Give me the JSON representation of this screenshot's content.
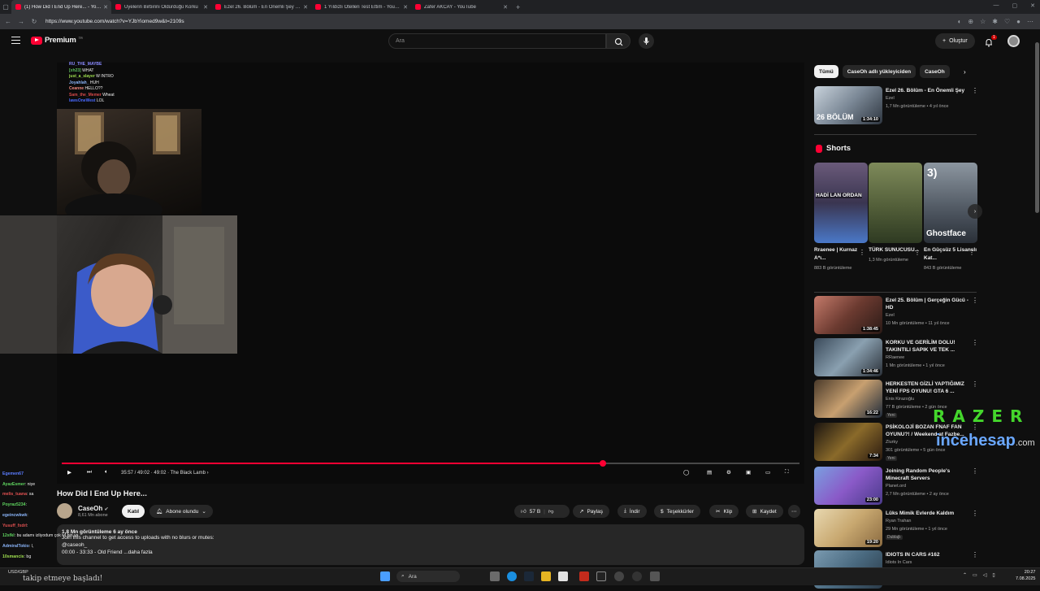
{
  "browser": {
    "tabs": [
      {
        "title": "(1) How Did I End Up Here... - YouTube",
        "active": true
      },
      {
        "title": "Üyelerin Birbirini Öldürdüğü Korku",
        "active": false
      },
      {
        "title": "Ezel 26. Bölüm - En Önemli Şey - YouTube",
        "active": false
      },
      {
        "title": "1 Yıldızlı Otelleri Test Ettim - YouTube",
        "active": false
      },
      {
        "title": "Zafer AKCAY - YouTube",
        "active": false
      }
    ],
    "url": "https://www.youtube.com/watch?v=YJbYiomed9w&t=2109s"
  },
  "header": {
    "logo_text": "Premium",
    "logo_sup": "TR",
    "search_placeholder": "Ara",
    "create_label": "Oluştur",
    "notifications_count": "1"
  },
  "player": {
    "overlay_chat": [
      {
        "user": "RU_THE_MAYBE",
        "msg": "",
        "color": "#8a8aff"
      },
      {
        "user": "[xh23]",
        "msg": "WHAT",
        "color": "#5fbf5f"
      },
      {
        "user": "just_a_slayer",
        "msg": "W INTRO",
        "color": "#9fdf4f"
      },
      {
        "user": "Joyahlah_",
        "msg": "HUH",
        "color": "#8ab4f8"
      },
      {
        "user": "Ceanne",
        "msg": "HELLO??",
        "color": "#f28b82"
      },
      {
        "user": "Sam_the_Memer",
        "msg": "Wheat",
        "color": "#d94a4a"
      },
      {
        "user": "lawsOneWest",
        "msg": "LOL",
        "color": "#4a6aff"
      }
    ],
    "time_current": "35:57",
    "time_total": "49:02",
    "chapter": "49:02 · The Black Lamb",
    "progress": 0.733
  },
  "video": {
    "title": "How Did I End Up Here...",
    "channel": "CaseOh",
    "subscribers": "8,61 Mn abone",
    "join_label": "Katıl",
    "subscribed_label": "Abone olundu",
    "likes": "57 B",
    "share_label": "Paylaş",
    "download_label": "İndir",
    "thanks_label": "Teşekkürler",
    "clip_label": "Klip",
    "save_label": "Kaydet",
    "desc_meta": "1,8 Mn görüntüleme  6 ay önce",
    "desc_line1": "Join this channel to get access to uploads with no blurs or mutes:",
    "desc_line2": "@caseoh_",
    "desc_line3": "00:00 - 33:33 - Old Friend",
    "desc_more": "...daha fazla"
  },
  "stream_chat": [
    {
      "user": "Egemen67",
      "msg": "",
      "color": "#5b7cff"
    },
    {
      "user": "AyazEsmer",
      "msg": ": niye",
      "color": "#5fd35f"
    },
    {
      "user": "melis_tuana",
      "msg": ": sa",
      "color": "#e05050"
    },
    {
      "user": "Poyraz5234",
      "msg": ": ",
      "color": "#5fd35f"
    },
    {
      "user": "egeincwkwk",
      "msg": ": ",
      "color": "#8ab4f8"
    },
    {
      "user": "Yusuff_fxdrl",
      "msg": ": ",
      "color": "#e05050"
    },
    {
      "user": "12sfkl",
      "msg": ": bu adamı izliyodum çok iyi biri ya",
      "color": "#5fd35f"
    },
    {
      "user": "AdmiralTokio",
      "msg": ": l,",
      "color": "#8ab4f8"
    },
    {
      "user": "10smancis",
      "msg": ": bg",
      "color": "#9fdf4f"
    }
  ],
  "sidebar": {
    "chips": [
      "Tümü",
      "CaseOh adlı yükleyiciden",
      "CaseOh"
    ],
    "first_video": {
      "title": "Ezel 26. Bölüm - En Önemli Şey",
      "channel": "Ezel",
      "stats": "1,7 Mn görüntüleme • 4 yıl önce",
      "duration": "1:34:10",
      "thumb_text": "26 BÖLÜM"
    },
    "shorts_title": "Shorts",
    "shorts": [
      {
        "title": "Rraenee | Kurnaz A*ı...",
        "views": "883 B görüntüleme",
        "thumb_text": "HADİ LAN ORDAN"
      },
      {
        "title": "TÜRK SUNUCUSU...",
        "views": "1,3 Mn görüntüleme",
        "thumb_text": ""
      },
      {
        "title": "En Güçsüz 5 Lisanslı Kat...",
        "views": "843 B görüntüleme",
        "thumb_text": "Ghostface"
      }
    ],
    "videos": [
      {
        "title": "Ezel 25. Bölüm | Gerçeğin Gücü - HD",
        "channel": "Ezel",
        "stats": "10 Mn görüntüleme • 11 yıl önce",
        "duration": "1:38:45",
        "badge": ""
      },
      {
        "title": "KORKU VE GERİLİM DOLU! TAKINTILI SAPIK VE TEK ...",
        "channel": "RRaenee",
        "stats": "1 Mn görüntüleme • 1 yıl önce",
        "duration": "1:34:46",
        "badge": ""
      },
      {
        "title": "HERKESTEN GİZLİ YAPTIĞIMIZ YENİ FPS OYUNU! GTA 6 ...",
        "channel": "Enis Kirazoğlu",
        "stats": "77 B görüntüleme • 2 gün önce",
        "duration": "16:22",
        "badge": "Yeni"
      },
      {
        "title": "PSİKOLOJİ BOZAN FNAF FAN OYUNU?! / Weekend at Fazbe...",
        "channel": "Zlurky",
        "stats": "301 görüntüleme • 5 gün önce",
        "duration": "7:34",
        "badge": "Yeni"
      },
      {
        "title": "Joining Random People's Minecraft Servers",
        "channel": "Planet.ord",
        "stats": "2,7 Mn görüntüleme • 2 ay önce",
        "duration": "23:00",
        "badge": ""
      },
      {
        "title": "Lüks Mimik Evlerde Kaldım",
        "channel": "Ryan Trahan",
        "stats": "29 Mn görüntüleme • 1 yıl önce",
        "duration": "19:20",
        "badge": "Dublajlı"
      },
      {
        "title": "IDIOTS IN CARS #162",
        "channel": "Idiots In Cars",
        "stats": "",
        "duration": "",
        "badge": ""
      }
    ]
  },
  "watermark": {
    "razer": "RAZER",
    "ince": "incehesap",
    "com": ".com"
  },
  "taskbar": {
    "weather": "USD/GBP",
    "follow_msg": "takip etmeye başladı!",
    "search": "Ara",
    "time": "20:27",
    "date": "7.08.2025"
  }
}
